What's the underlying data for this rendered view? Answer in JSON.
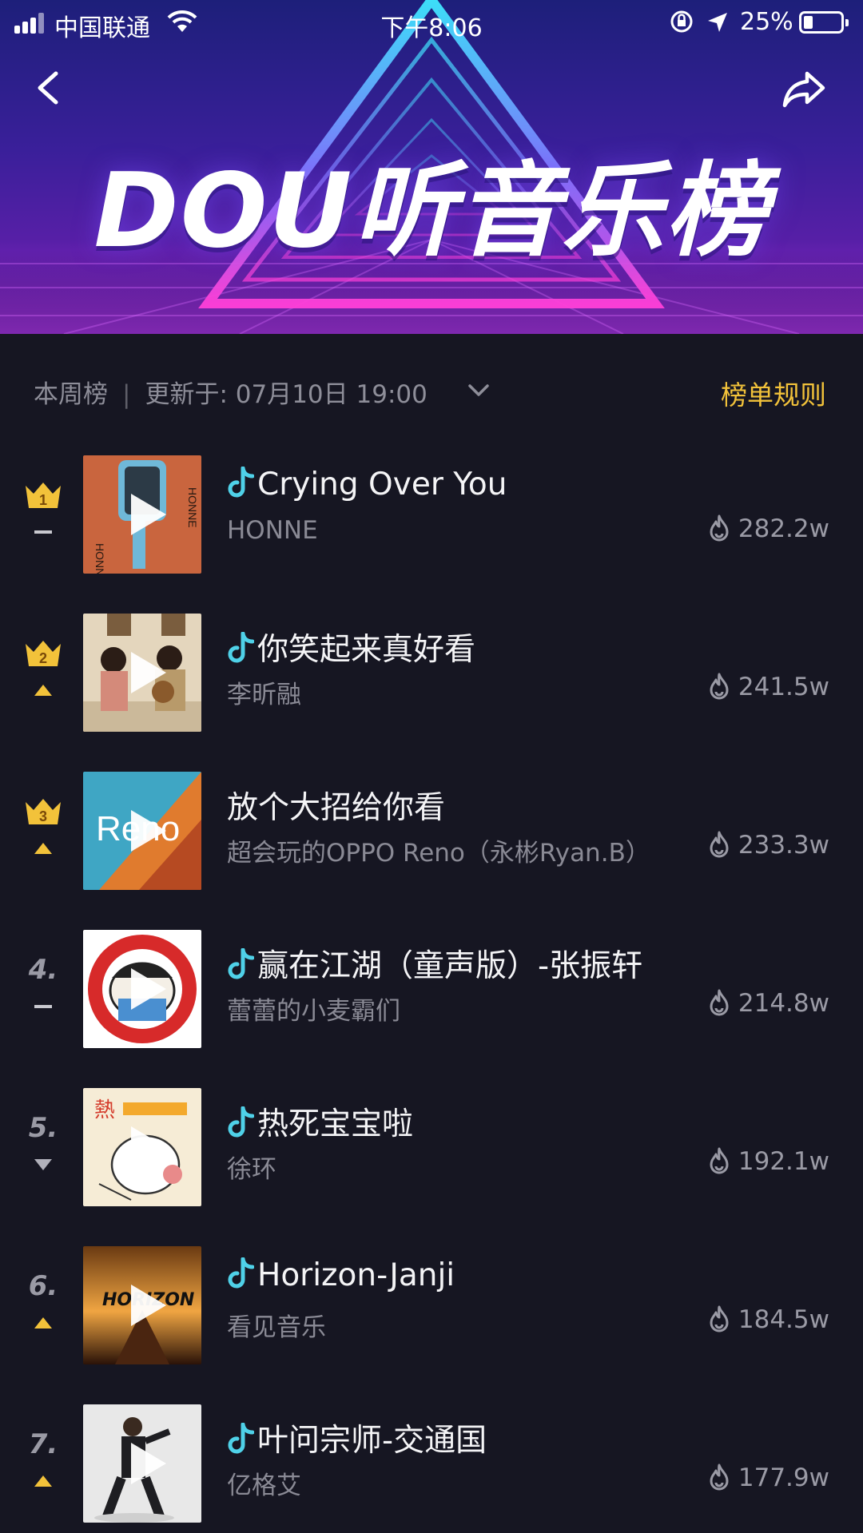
{
  "status_bar": {
    "carrier": "中国联通",
    "time": "下午8:06",
    "battery_percent": "25%",
    "battery_level": 0.25
  },
  "banner": {
    "title": "DOU听音乐榜"
  },
  "list_header": {
    "period": "本周榜",
    "divider": "|",
    "updated": "更新于: 07月10日 19:00",
    "rules_link": "榜单规则"
  },
  "songs": [
    {
      "rank": "1",
      "crown": true,
      "trend": "same",
      "has_note": true,
      "title": "Crying Over You",
      "artist": "HONNE",
      "heat": "282.2w"
    },
    {
      "rank": "2",
      "crown": true,
      "trend": "up",
      "has_note": true,
      "title": "你笑起来真好看",
      "artist": "李昕融",
      "heat": "241.5w"
    },
    {
      "rank": "3",
      "crown": true,
      "trend": "up",
      "has_note": false,
      "title": "放个大招给你看",
      "artist": "超会玩的OPPO Reno（永彬Ryan.B）",
      "heat": "233.3w"
    },
    {
      "rank": "4.",
      "crown": false,
      "trend": "same",
      "has_note": true,
      "title": "赢在江湖（童声版）-张振轩",
      "artist": "蕾蕾的小麦霸们",
      "heat": "214.8w"
    },
    {
      "rank": "5.",
      "crown": false,
      "trend": "down",
      "has_note": true,
      "title": "热死宝宝啦",
      "artist": "徐环",
      "heat": "192.1w"
    },
    {
      "rank": "6.",
      "crown": false,
      "trend": "up",
      "has_note": true,
      "title": "Horizon-Janji",
      "artist": "看见音乐",
      "heat": "184.5w"
    },
    {
      "rank": "7.",
      "crown": false,
      "trend": "up",
      "has_note": true,
      "title": "叶问宗师-交通国",
      "artist": "亿格艾",
      "heat": "177.9w"
    }
  ],
  "colors": {
    "background": "#161622",
    "accent_gold": "#f2c23a",
    "note_cyan": "#4fd1e8",
    "trend_up": "#f2c23a",
    "trend_down": "#b0b0ba",
    "trend_same": "#c8c8cf"
  },
  "icons": {
    "back": "chevron-left-icon",
    "share": "share-arrow-icon",
    "dropdown": "chevron-down-icon",
    "crown": "crown-icon",
    "note": "douyin-note-icon",
    "play": "play-icon",
    "heat": "flame-icon"
  }
}
